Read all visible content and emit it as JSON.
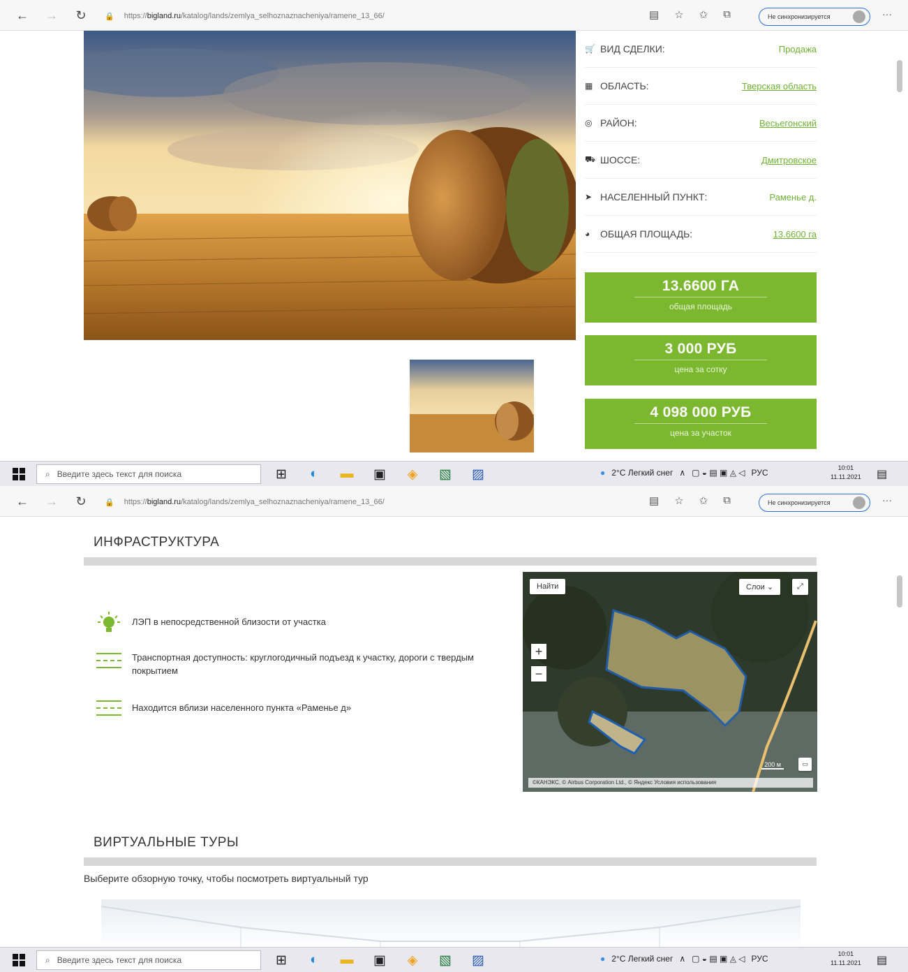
{
  "browser": {
    "url_prefix": "https://",
    "url_domain": "bigland.ru",
    "url_path": "/katalog/lands/zemlya_selhoznaznacheniya/ramene_13_66/",
    "sync_label": "Не синхронизируется"
  },
  "taskbar": {
    "search_placeholder": "Введите здесь текст для поиска",
    "weather": "2°C  Легкий снег",
    "lang": "РУС",
    "time": "10:01",
    "date": "11.11.2021"
  },
  "properties": [
    {
      "icon": "cart-icon",
      "glyph": "🛒",
      "label": "Вид сделки:",
      "value": "Продажа",
      "link": false
    },
    {
      "icon": "map-icon",
      "glyph": "▦",
      "label": "Область:",
      "value": "Тверская область",
      "link": true
    },
    {
      "icon": "target-icon",
      "glyph": "◎",
      "label": "Район:",
      "value": "Весьегонский",
      "link": true
    },
    {
      "icon": "road-icon",
      "glyph": "⛟",
      "label": "Шоссе:",
      "value": "Дмитровское",
      "link": true
    },
    {
      "icon": "location-arrow-icon",
      "glyph": "➤",
      "label": "Населенный пункт:",
      "value": "Раменье д.",
      "link": false
    },
    {
      "icon": "globe-icon",
      "glyph": "◕",
      "label": "Общая площадь:",
      "value": "13.6600 га",
      "link": true
    }
  ],
  "summary": [
    {
      "value": "13.6600 ГА",
      "label": "общая площадь"
    },
    {
      "value": "3 000 РУБ",
      "label": "цена за сотку"
    },
    {
      "value": "4 098 000 РУБ",
      "label": "цена за участок"
    }
  ],
  "infrastructure": {
    "title": "ИНФРАСТРУКТУРА",
    "items": [
      "ЛЭП в непосредственной близости от участка",
      "Транспортная доступность: круглогодичный подъезд к участку, дороги с твердым покрытием",
      "Находится вблизи населенного пункта «Раменье д»"
    ]
  },
  "map": {
    "find": "Найти",
    "layers": "Слои",
    "scale": "200 м",
    "copyright": "©КАНЭКС, © Airbus Corporation Ltd., © Яндекс Условия использования"
  },
  "tours": {
    "title": "ВИРТУАЛЬНЫЕ ТУРЫ",
    "text": "Выберите обзорную точку, чтобы посмотреть виртуальный тур"
  },
  "colors": {
    "accent": "#7cb82f",
    "link": "#6fb236"
  }
}
